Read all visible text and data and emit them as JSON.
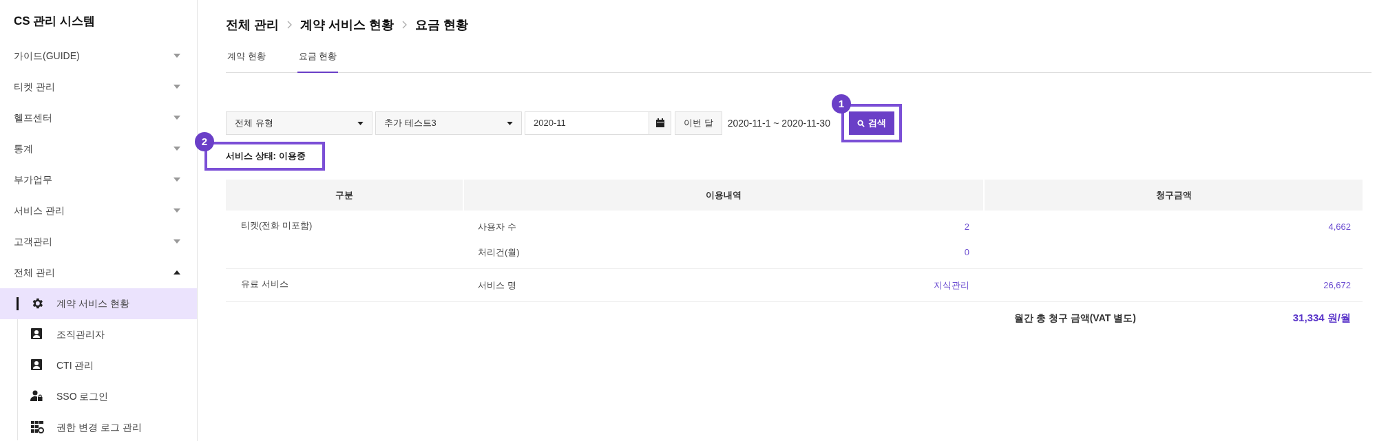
{
  "sidebar": {
    "title": "CS 관리 시스템",
    "items": [
      {
        "label": "가이드(GUIDE)",
        "expanded": false
      },
      {
        "label": "티켓 관리",
        "expanded": false
      },
      {
        "label": "헬프센터",
        "expanded": false
      },
      {
        "label": "통계",
        "expanded": false
      },
      {
        "label": "부가업무",
        "expanded": false
      },
      {
        "label": "서비스 관리",
        "expanded": false
      },
      {
        "label": "고객관리",
        "expanded": false
      },
      {
        "label": "전체 관리",
        "expanded": true,
        "children": [
          {
            "label": "계약 서비스 현황",
            "selected": true
          },
          {
            "label": "조직관리자",
            "selected": false
          },
          {
            "label": "CTI 관리",
            "selected": false
          },
          {
            "label": "SSO 로그인",
            "selected": false
          },
          {
            "label": "권한 변경 로그 관리",
            "selected": false
          }
        ]
      }
    ]
  },
  "breadcrumb": [
    "전체 관리",
    "계약 서비스 현황",
    "요금 현황"
  ],
  "tabs": [
    {
      "label": "계약 현황",
      "selected": false
    },
    {
      "label": "요금 현황",
      "selected": true
    }
  ],
  "filters": {
    "type_select": "전체 유형",
    "company_select": "추가 테스트3",
    "month_field": "2020-11",
    "this_month_button": "이번 달",
    "date_range": "2020-11-1 ~ 2020-11-30",
    "search_button": {
      "label": "검색",
      "annotation": "1"
    }
  },
  "service_status": {
    "text": "서비스 상태: 이용중",
    "annotation": "2"
  },
  "table": {
    "columns": [
      "구분",
      "이용내역",
      "청구금액"
    ],
    "rows": [
      {
        "category": "티켓(전화 미포함)",
        "lines": [
          {
            "label": "사용자 수",
            "usage": "2",
            "amount": "4,662"
          },
          {
            "label": "처리건(월)",
            "usage": "0"
          }
        ]
      },
      {
        "category": "유료 서비스",
        "lines": [
          {
            "label": "서비스 명",
            "usage": "지식관리",
            "amount": "26,672"
          }
        ]
      }
    ],
    "total": {
      "label": "월간 총 청구 금액(VAT 별도)",
      "value": "31,334 원/월"
    }
  }
}
